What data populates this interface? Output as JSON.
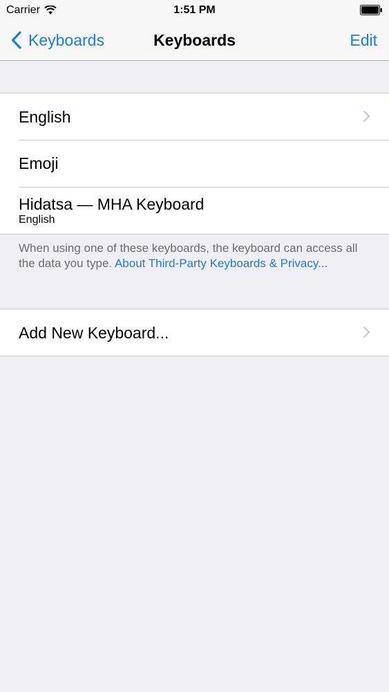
{
  "status_bar": {
    "carrier": "Carrier",
    "time": "1:51 PM",
    "icons": [
      "wifi-icon",
      "battery-icon"
    ]
  },
  "nav_bar": {
    "back_label": "Keyboards",
    "title": "Keyboards",
    "edit_label": "Edit"
  },
  "keyboards": [
    {
      "label": "English",
      "subtitle": "",
      "has_chevron": true
    },
    {
      "label": "Emoji",
      "subtitle": "",
      "has_chevron": false
    },
    {
      "label": "Hidatsa — MHA Keyboard",
      "subtitle": "English",
      "has_chevron": false
    }
  ],
  "footer": {
    "text": "When using one of these keyboards, the keyboard can access all the data you type. ",
    "link": "About Third-Party Keyboards & Privacy..."
  },
  "add_keyboard": {
    "label": "Add New Keyboard..."
  },
  "colors": {
    "accent": "#1a7ee0",
    "background": "#efeff4",
    "footer_text": "#6d6d72",
    "separator": "#c8c7cc"
  }
}
